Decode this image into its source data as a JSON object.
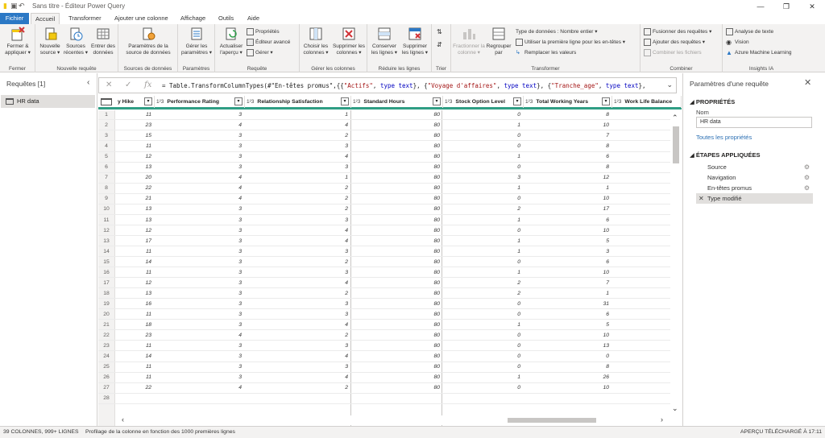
{
  "titlebar": {
    "title": "Sans titre - Éditeur Power Query"
  },
  "menu_tabs": [
    "Fichier",
    "Accueil",
    "Transformer",
    "Ajouter une colonne",
    "Affichage",
    "Outils",
    "Aide"
  ],
  "ribbon": {
    "groups": {
      "fermer": "Fermer",
      "nouvelle_requete": "Nouvelle requête",
      "sources": "Sources de données",
      "parametres": "Paramètres",
      "requete": "Requête",
      "gerer_colonnes": "Gérer les colonnes",
      "reduire": "Réduire les lignes",
      "trier": "Trier",
      "transformer": "Transformer",
      "combiner": "Combiner",
      "insights": "Insights IA"
    },
    "buttons": {
      "fermer": "Fermer & appliquer ▾",
      "nouvelle_source": "Nouvelle source ▾",
      "sources_recentes": "Sources récentes ▾",
      "entrer_donnees": "Entrer des données",
      "param_source": "Paramètres de la source de données",
      "gerer_params": "Gérer les paramètres ▾",
      "actualiser": "Actualiser l'aperçu ▾",
      "proprietes": "Propriétés",
      "editeur_avance": "Éditeur avancé",
      "gerer": "Gérer ▾",
      "choisir_colonnes": "Choisir les colonnes ▾",
      "supprimer_colonnes": "Supprimer les colonnes ▾",
      "conserver_lignes": "Conserver les lignes ▾",
      "supprimer_lignes": "Supprimer les lignes ▾",
      "fractionner": "Fractionner la colonne ▾",
      "regrouper": "Regrouper par",
      "type_donnees": "Type de données : Nombre entier ▾",
      "premiere_ligne": "Utiliser la première ligne pour les en-têtes ▾",
      "remplacer": "Remplacer les valeurs",
      "fusionner": "Fusionner des requêtes ▾",
      "ajouter_req": "Ajouter des requêtes ▾",
      "combiner_fichiers": "Combiner les fichiers",
      "analyse_texte": "Analyse de texte",
      "vision": "Vision",
      "azure_ml": "Azure Machine Learning"
    }
  },
  "left_pane": {
    "header": "Requêtes [1]",
    "query": "HR data"
  },
  "formula": {
    "prefix": "= Table.TransformColumnTypes(#\"En-têtes promus\",{{",
    "s1": "\"Actifs\"",
    "k1": "type text",
    "s2": "\"Voyage d'affaires\"",
    "k2": "type text",
    "s3": "\"Tranche_age\"",
    "k3": "type text",
    "suffix": "},"
  },
  "columns": [
    {
      "name": "y Hike",
      "type": "1²3"
    },
    {
      "name": "Performance Rating",
      "type": "1²3"
    },
    {
      "name": "Relationship Satisfaction",
      "type": "1²3"
    },
    {
      "name": "Standard Hours",
      "type": "1²3"
    },
    {
      "name": "Stock Option Level",
      "type": "1²3"
    },
    {
      "name": "Total Working Years",
      "type": "1²3"
    },
    {
      "name": "Work Life Balance",
      "type": "1²3"
    }
  ],
  "rows": [
    [
      1,
      11,
      3,
      1,
      80,
      0,
      8
    ],
    [
      2,
      23,
      4,
      4,
      80,
      1,
      10
    ],
    [
      3,
      15,
      3,
      2,
      80,
      0,
      7
    ],
    [
      4,
      11,
      3,
      3,
      80,
      0,
      8
    ],
    [
      5,
      12,
      3,
      4,
      80,
      1,
      6
    ],
    [
      6,
      13,
      3,
      3,
      80,
      0,
      8
    ],
    [
      7,
      20,
      4,
      1,
      80,
      3,
      12
    ],
    [
      8,
      22,
      4,
      2,
      80,
      1,
      1
    ],
    [
      9,
      21,
      4,
      2,
      80,
      0,
      10
    ],
    [
      10,
      13,
      3,
      2,
      80,
      2,
      17
    ],
    [
      11,
      13,
      3,
      3,
      80,
      1,
      6
    ],
    [
      12,
      12,
      3,
      4,
      80,
      0,
      10
    ],
    [
      13,
      17,
      3,
      4,
      80,
      1,
      5
    ],
    [
      14,
      11,
      3,
      3,
      80,
      1,
      3
    ],
    [
      15,
      14,
      3,
      2,
      80,
      0,
      6
    ],
    [
      16,
      11,
      3,
      3,
      80,
      1,
      10
    ],
    [
      17,
      12,
      3,
      4,
      80,
      2,
      7
    ],
    [
      18,
      13,
      3,
      2,
      80,
      2,
      1
    ],
    [
      19,
      16,
      3,
      3,
      80,
      0,
      31
    ],
    [
      20,
      11,
      3,
      3,
      80,
      0,
      6
    ],
    [
      21,
      18,
      3,
      4,
      80,
      1,
      5
    ],
    [
      22,
      23,
      4,
      2,
      80,
      0,
      10
    ],
    [
      23,
      11,
      3,
      3,
      80,
      0,
      13
    ],
    [
      24,
      14,
      3,
      4,
      80,
      0,
      0
    ],
    [
      25,
      11,
      3,
      3,
      80,
      0,
      8
    ],
    [
      26,
      11,
      3,
      4,
      80,
      1,
      26
    ],
    [
      27,
      22,
      4,
      2,
      80,
      0,
      10
    ],
    [
      28,
      "",
      "",
      "",
      "",
      "",
      ""
    ]
  ],
  "right_pane": {
    "title": "Paramètres d'une requête",
    "props_header": "PROPRIÉTÉS",
    "name_label": "Nom",
    "name_value": "HR data",
    "all_props": "Toutes les propriétés",
    "steps_header": "ÉTAPES APPLIQUÉES",
    "steps": [
      "Source",
      "Navigation",
      "En-têtes promus",
      "Type modifié"
    ]
  },
  "status": {
    "left": "39 COLONNES, 999+ LIGNES",
    "profile": "Profilage de la colonne en fonction des 1000 premières lignes",
    "right": "APERÇU TÉLÉCHARGÉ À 17:11"
  },
  "colors": {
    "accent": "#2b78c5",
    "header_bar": "#2f9e84",
    "ribbon_bg": "#f3f2f1",
    "link": "#2b6fb3"
  }
}
